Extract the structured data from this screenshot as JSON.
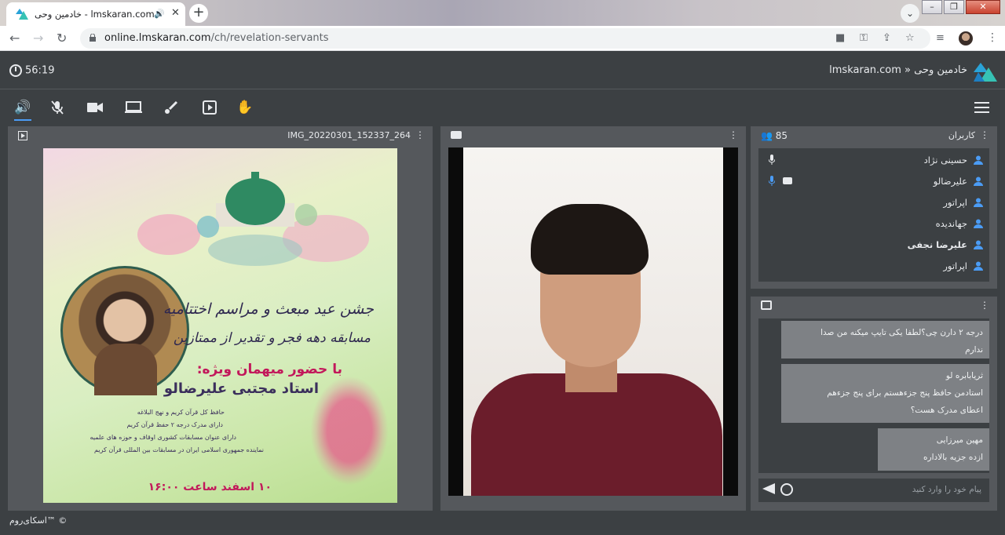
{
  "browser": {
    "tab_title": "خادمین وحی - lmskaran.com",
    "url_domain": "online.lmskaran.com",
    "url_path": "/ch/revelation-servants"
  },
  "header": {
    "timer": "56:19",
    "breadcrumb": "lmskaran.com » خادمین وحی"
  },
  "presentation": {
    "filename": "IMG_20220301_152337_264",
    "poster": {
      "line1": "جشن عید مبعث و مراسم اختتامیه",
      "line2": "مسابقه دهه فجر و تقدیر از ممتازین",
      "line3": "با حضور میهمان ویژه:",
      "line4": "استاد مجتبی علیرضالو",
      "line5": "حافظ کل قرآن کریم و نهج البلاغه",
      "line6": "دارای مدرک درجه ۲ حفظ قرآن کریم",
      "line7": "دارای عنوان مسابقات کشوری اوقاف و حوزه های علمیه",
      "line8": "نماینده جمهوری اسلامی ایران در مسابقات بین المللی قرآن کریم",
      "date": "۱۰ اسفند  ساعت ۱۶:۰۰"
    }
  },
  "users": {
    "label": "کاربران",
    "count": "85",
    "list": [
      {
        "name": "حسینی نژاد",
        "bold": false,
        "mic": true,
        "cam": false
      },
      {
        "name": "علیرضالو",
        "bold": false,
        "mic": true,
        "cam": true
      },
      {
        "name": "اپراتور",
        "bold": false,
        "mic": false,
        "cam": false
      },
      {
        "name": "جهاندیده",
        "bold": false,
        "mic": false,
        "cam": false
      },
      {
        "name": "علیرضا نجفی",
        "bold": true,
        "mic": false,
        "cam": false
      },
      {
        "name": "اپراتور",
        "bold": false,
        "mic": false,
        "cam": false
      }
    ]
  },
  "chat": {
    "messages": [
      {
        "lines": [
          "درجه ۲ دارن چی؟لطفا یکی تایپ میکنه من صدا",
          "ندارم"
        ]
      },
      {
        "lines": [
          "ثریابابره لو",
          "استادمن حافظ پنج جزءهستم برای پنج جزءهم",
          "اعطای مدرک هست؟"
        ]
      },
      {
        "lines": [
          "مهین میرزایی",
          "ازده جزیه بالاداره"
        ]
      }
    ],
    "placeholder": "پیام خود را وارد کنید"
  },
  "footer": "اسکای‌روم™ ©"
}
